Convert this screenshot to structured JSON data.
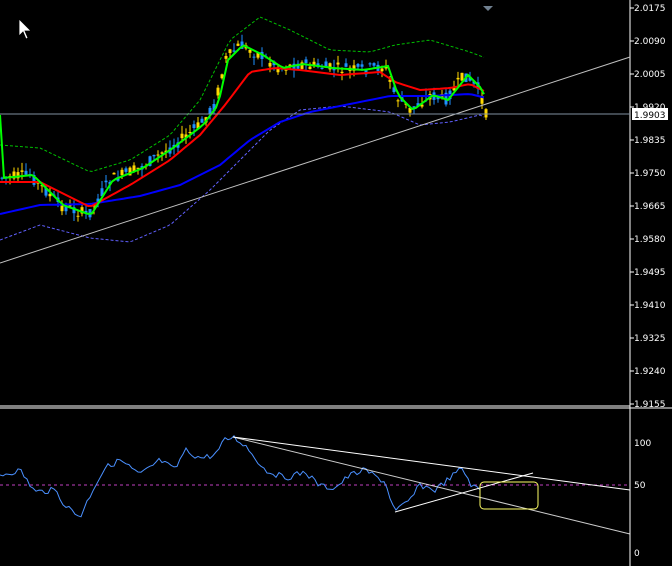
{
  "main_panel": {
    "price_axis_labels": [
      "2.0175",
      "2.0090",
      "2.0005",
      "1.9920",
      "1.9835",
      "1.9750",
      "1.9665",
      "1.9580",
      "1.9495",
      "1.9410",
      "1.9325",
      "1.9240",
      "1.9155"
    ],
    "current_price": "1.9903",
    "colors": {
      "background": "#000000",
      "bull_candle": "#ffd700",
      "bear_candle": "#1e90ff",
      "ma_fast": "#00ff00",
      "ma_mid": "#ff0000",
      "ma_slow": "#0000ff",
      "envelope_upper": "#00c000",
      "envelope_lower": "#6060ff",
      "trendline": "#c0c0c0",
      "price_line": "#8090a0"
    },
    "icons": [
      "mouse-cursor-icon",
      "scroll-marker-icon"
    ]
  },
  "oscillator_panel": {
    "axis_labels": [
      "100",
      "50",
      "0"
    ],
    "colors": {
      "line": "#4a90ff",
      "level": "#c040c0",
      "trendline": "#ffffff",
      "highlight_box": "#ffff66"
    }
  }
}
